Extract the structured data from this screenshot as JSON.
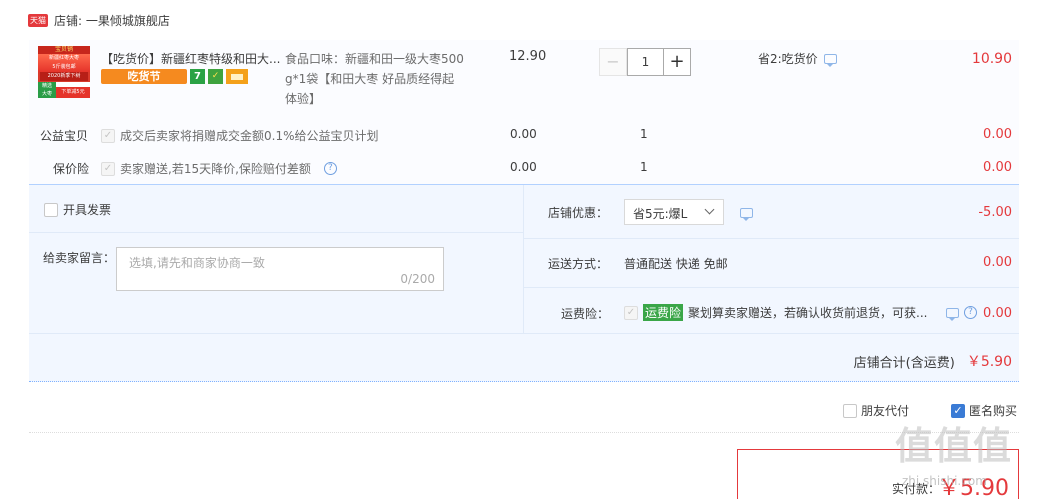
{
  "shop": {
    "badge": "天猫",
    "label": "店铺: 一果倾城旗舰店"
  },
  "item": {
    "thumb": {
      "top": "宝贝销",
      "mid1": "新疆红枣大枣",
      "mid2": "5斤装包邮",
      "new": "2020新季下树",
      "bl1": "精选",
      "bl2": "大枣",
      "br": "下单减5元"
    },
    "title": "【吃货价】新疆红枣特级和田大...",
    "promo_tag": "吃货节",
    "sku_line1": "食品口味：新疆和田一级大枣500",
    "sku_line2": "g*1袋【和田大枣 好品质经得起",
    "sku_line3": "体验】",
    "unit_price": "12.90",
    "qty": "1",
    "minus": "−",
    "plus": "+",
    "discount": "省2:吃货价",
    "total": "10.90"
  },
  "charity": {
    "label": "公益宝贝",
    "desc": "成交后卖家将捐赠成交金额0.1%给公益宝贝计划",
    "price": "0.00",
    "qty": "1",
    "total": "0.00"
  },
  "insurance": {
    "label": "保价险",
    "desc": "卖家赠送,若15天降价,保险赔付差额",
    "help": "?",
    "price": "0.00",
    "qty": "1",
    "total": "0.00"
  },
  "invoice": {
    "label": "开具发票"
  },
  "message": {
    "label": "给卖家留言：",
    "placeholder": "选填,请先和商家协商一致",
    "counter": "0/200"
  },
  "shop_discount": {
    "label": "店铺优惠：",
    "selected": "省5元:爆L",
    "amount": "-5.00"
  },
  "shipping": {
    "label": "运送方式：",
    "value": "普通配送 快递 免邮",
    "amount": "0.00"
  },
  "freight_ins": {
    "label": "运费险：",
    "tag": "运费险",
    "desc": "聚划算卖家赠送，若确认收货前退货，可获...",
    "amount": "0.00"
  },
  "subtotal": {
    "label": "店铺合计(含运费)",
    "amount": "￥5.90"
  },
  "options": {
    "friend_pay": "朋友代付",
    "anonymous": "匿名购买"
  },
  "pay": {
    "label": "实付款：",
    "amount": "￥5.90"
  },
  "watermark": {
    "text": "值值值",
    "sub": "zhi.shishi.com"
  }
}
